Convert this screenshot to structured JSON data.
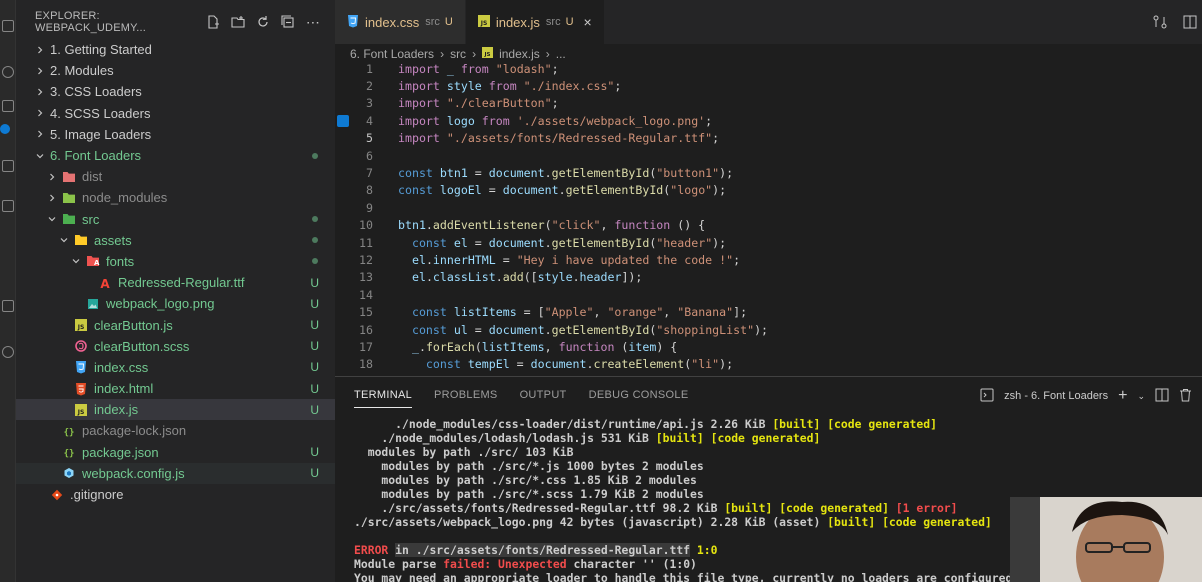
{
  "explorer": {
    "title": "EXPLORER: WEBPACK_UDEMY...",
    "items": [
      {
        "label": "1. Getting Started",
        "indent": 0,
        "type": "folder",
        "open": false
      },
      {
        "label": "2. Modules",
        "indent": 0,
        "type": "folder",
        "open": false
      },
      {
        "label": "3. CSS Loaders",
        "indent": 0,
        "type": "folder",
        "open": false
      },
      {
        "label": "4. SCSS Loaders",
        "indent": 0,
        "type": "folder",
        "open": false
      },
      {
        "label": "5. Image Loaders",
        "indent": 0,
        "type": "folder",
        "open": false
      },
      {
        "label": "6. Font Loaders",
        "indent": 0,
        "type": "folder",
        "open": true
      },
      {
        "label": "dist",
        "indent": 1,
        "type": "folder",
        "open": false
      },
      {
        "label": "node_modules",
        "indent": 1,
        "type": "folder",
        "open": false
      },
      {
        "label": "src",
        "indent": 1,
        "type": "folder",
        "open": true
      },
      {
        "label": "assets",
        "indent": 2,
        "type": "folder",
        "open": true
      },
      {
        "label": "fonts",
        "indent": 3,
        "type": "folder",
        "open": true
      },
      {
        "label": "Redressed-Regular.ttf",
        "indent": 4,
        "type": "file",
        "status": "U"
      },
      {
        "label": "webpack_logo.png",
        "indent": 3,
        "type": "file",
        "status": "U"
      },
      {
        "label": "clearButton.js",
        "indent": 2,
        "type": "file",
        "status": "U"
      },
      {
        "label": "clearButton.scss",
        "indent": 2,
        "type": "file",
        "status": "U"
      },
      {
        "label": "index.css",
        "indent": 2,
        "type": "file",
        "status": "U"
      },
      {
        "label": "index.html",
        "indent": 2,
        "type": "file",
        "status": "U"
      },
      {
        "label": "index.js",
        "indent": 2,
        "type": "file",
        "status": "U"
      },
      {
        "label": "package-lock.json",
        "indent": 1,
        "type": "file",
        "status": ""
      },
      {
        "label": "package.json",
        "indent": 1,
        "type": "file",
        "status": "U"
      },
      {
        "label": "webpack.config.js",
        "indent": 1,
        "type": "file",
        "status": "U"
      },
      {
        "label": ".gitignore",
        "indent": 0,
        "type": "file",
        "status": ""
      }
    ]
  },
  "tabs": [
    {
      "name": "index.css",
      "dir": "src",
      "status": "U"
    },
    {
      "name": "index.js",
      "dir": "src",
      "status": "U",
      "close": "×"
    }
  ],
  "breadcrumb": [
    "6. Font Loaders",
    "src",
    "index.js",
    "..."
  ],
  "code_lines": [
    {
      "n": "1",
      "t": "import _ from \"lodash\";"
    },
    {
      "n": "2",
      "t": "import style from \"./index.css\";"
    },
    {
      "n": "3",
      "t": "import \"./clearButton\";"
    },
    {
      "n": "4",
      "t": "import logo from './assets/webpack_logo.png';"
    },
    {
      "n": "5",
      "t": "import \"./assets/fonts/Redressed-Regular.ttf\";"
    },
    {
      "n": "6",
      "t": ""
    },
    {
      "n": "7",
      "t": "const btn1 = document.getElementById(\"button1\");"
    },
    {
      "n": "8",
      "t": "const logoEl = document.getElementById(\"logo\");"
    },
    {
      "n": "9",
      "t": ""
    },
    {
      "n": "10",
      "t": "btn1.addEventListener(\"click\", function () {"
    },
    {
      "n": "11",
      "t": "  const el = document.getElementById(\"header\");"
    },
    {
      "n": "12",
      "t": "  el.innerHTML = \"Hey i have updated the code !\";"
    },
    {
      "n": "13",
      "t": "  el.classList.add([style.header]);"
    },
    {
      "n": "14",
      "t": ""
    },
    {
      "n": "15",
      "t": "  const listItems = [\"Apple\", \"orange\", \"Banana\"];"
    },
    {
      "n": "16",
      "t": "  const ul = document.getElementById(\"shoppingList\");"
    },
    {
      "n": "17",
      "t": "  _.forEach(listItems, function (item) {"
    },
    {
      "n": "18",
      "t": "    const tempEl = document.createElement(\"li\");"
    }
  ],
  "panel": {
    "tabs": [
      "TERMINAL",
      "PROBLEMS",
      "OUTPUT",
      "DEBUG CONSOLE"
    ],
    "shell": "zsh - 6. Font Loaders"
  },
  "terminal": [
    "      ./node_modules/css-loader/dist/runtime/api.js 2.26 KiB [built] [code generated]",
    "    ./node_modules/lodash/lodash.js 531 KiB [built] [code generated]",
    "  modules by path ./src/ 103 KiB",
    "    modules by path ./src/*.js 1000 bytes 2 modules",
    "    modules by path ./src/*.css 1.85 KiB 2 modules",
    "    modules by path ./src/*.scss 1.79 KiB 2 modules",
    "    ./src/assets/fonts/Redressed-Regular.ttf 98.2 KiB [built] [code generated] [1 error]",
    "./src/assets/webpack_logo.png 42 bytes (javascript) 2.28 KiB (asset) [built] [code generated]",
    "",
    "ERROR in ./src/assets/fonts/Redressed-Regular.ttf 1:0",
    "Module parse failed: Unexpected character '' (1:0)",
    "You may need an appropriate loader to handle this file type, currently no loaders are configured to"
  ]
}
